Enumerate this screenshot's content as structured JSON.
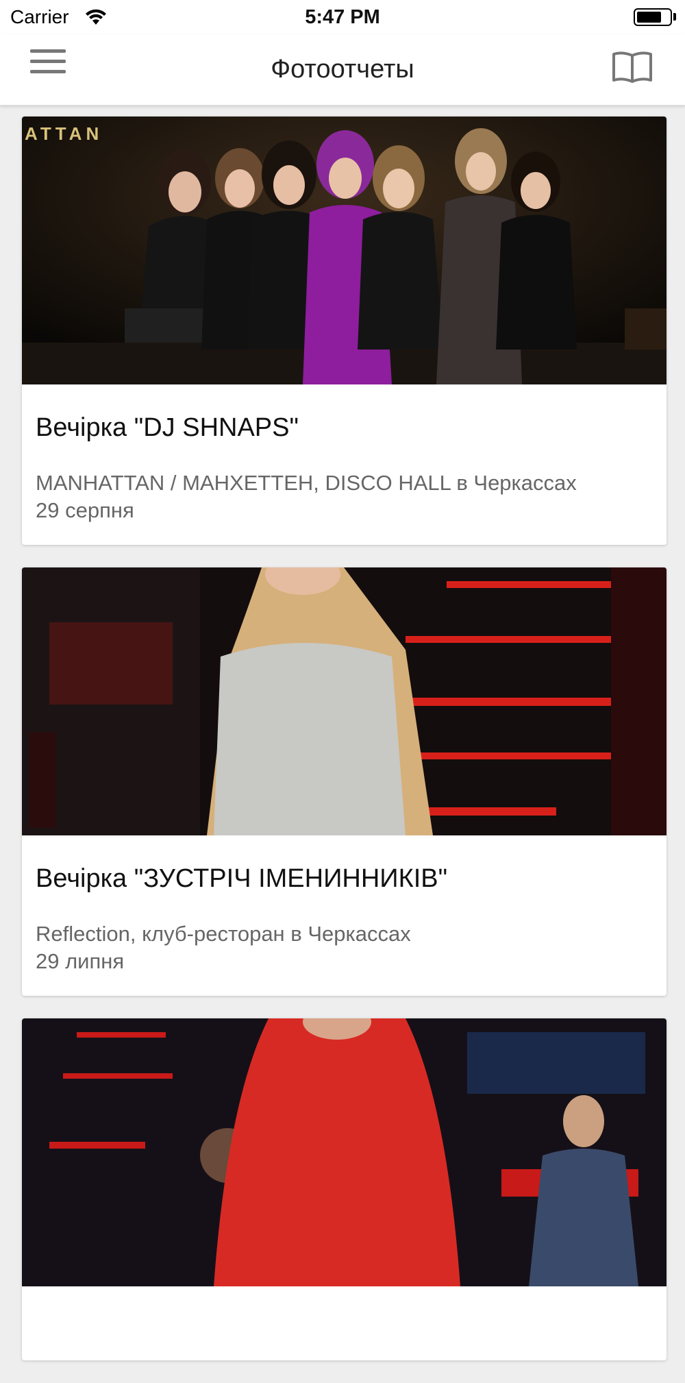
{
  "status_bar": {
    "carrier": "Carrier",
    "time": "5:47 PM",
    "battery_level": 0.75
  },
  "nav": {
    "title": "Фотоотчеты",
    "left_icon": "menu-icon",
    "right_icon": "book-icon"
  },
  "cards": [
    {
      "title": "Вечірка \"DJ SHNAPS\"",
      "venue": "MANHATTAN / МАНХЕТТЕН, DISCO HALL в Черкассах",
      "date": "29 серпня",
      "photo_text": "ATTAN"
    },
    {
      "title": "Вечірка \"ЗУСТРІЧ ІМЕНИННИКІВ\"",
      "venue": "Reflection, клуб-ресторан в Черкассах",
      "date": "29 липня"
    },
    {
      "title": "",
      "venue": "",
      "date": ""
    }
  ],
  "colors": {
    "background": "#eeeeee",
    "card": "#ffffff",
    "title": "#111111",
    "subtitle": "#666666"
  }
}
